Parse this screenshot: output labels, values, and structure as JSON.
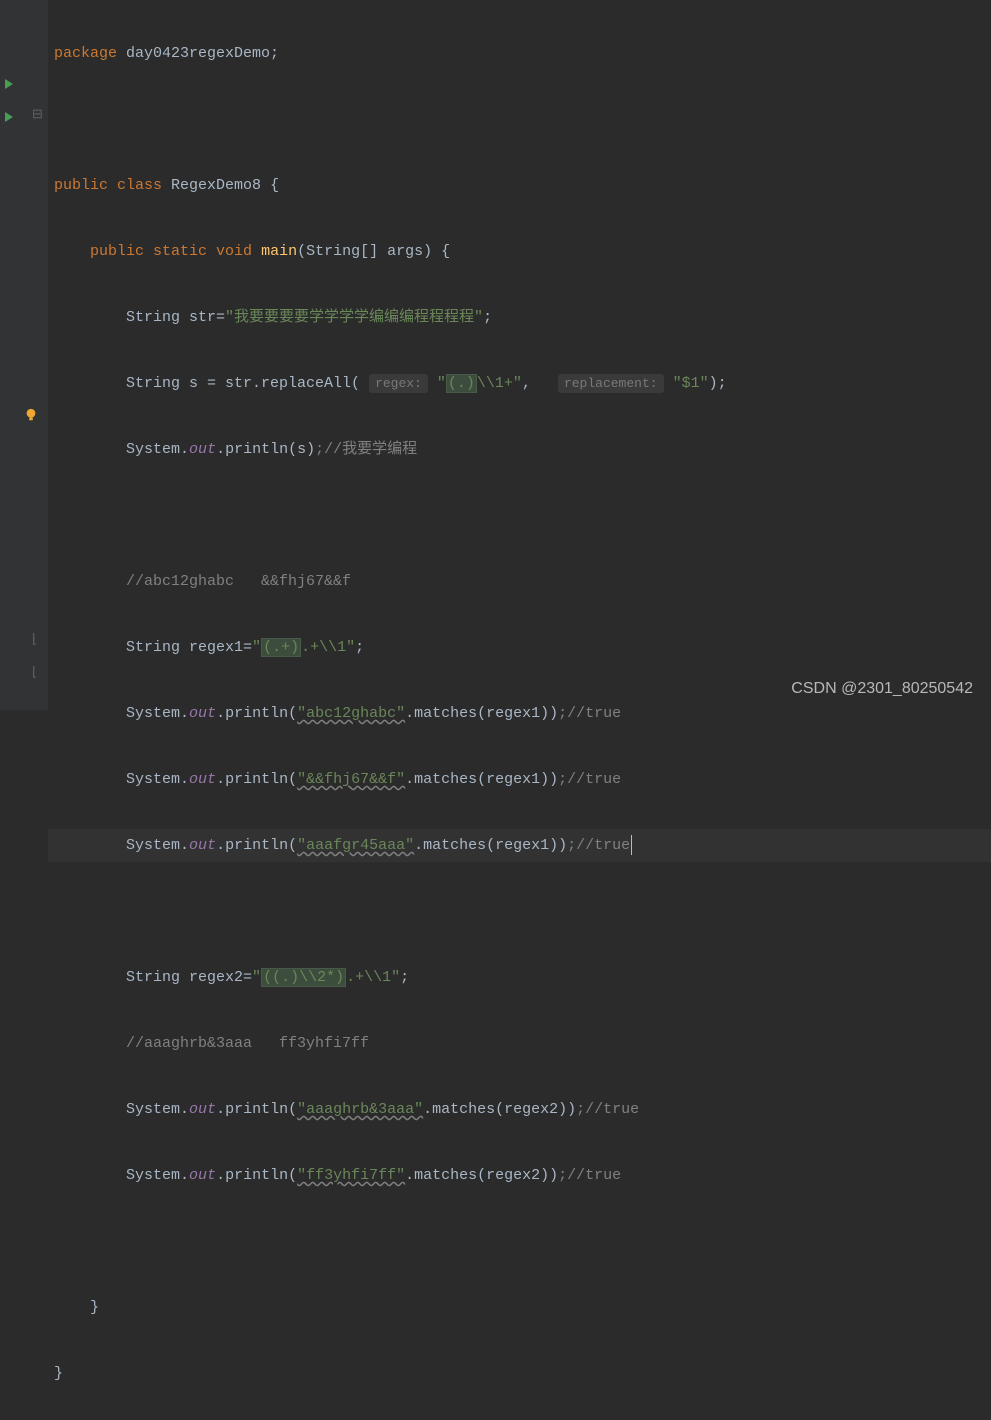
{
  "watermark": "CSDN @2301_80250542",
  "code": {
    "package_kw": "package ",
    "package_name": "day0423regexDemo",
    "semi": ";",
    "public": "public ",
    "class_kw": "class ",
    "class_name": "RegexDemo8 ",
    "brace_o": "{",
    "brace_c": "}",
    "static": "static ",
    "void": "void ",
    "main": "main",
    "main_params": "(String[] args) ",
    "str_decl": "String str=",
    "str_val": "\"我要要要要学学学学编编编程程程程\"",
    "s_decl": "String s = str.replaceAll( ",
    "regex_hint": "regex:",
    "regex_val_open": "\"",
    "regex_val_hl": "(.)",
    "regex_val_rest": "\\\\1+\"",
    "comma": ",   ",
    "repl_hint": "replacement:",
    "repl_val": " \"$1\"",
    "paren_close": ")",
    "sout": "System",
    "dot": ".",
    "out": "out",
    "println": "println",
    "s_arg": "(s)",
    "cmt1": ";//我要学编程",
    "cmt2": "//abc12ghabc   &&fhj67&&f",
    "regex1_decl": "String regex1=",
    "regex1_open": "\"",
    "regex1_hl": "(.+)",
    "regex1_rest": ".+\\\\1\"",
    "m1_open": "(",
    "m1_str": "\"abc12ghabc\"",
    "m1_call": ".matches(regex1))",
    "cmt_true": ";//true",
    "m2_str": "\"&&fhj67&&f\"",
    "m3_str": "\"aaafgr45aaa\"",
    "regex2_decl": "String regex2=",
    "regex2_open": "\"",
    "regex2_hl": "((.)\\\\2*)",
    "regex2_rest": ".+\\\\1\"",
    "cmt3": "//aaaghrb&3aaa   ff3yhfi7ff",
    "m4_str": "\"aaaghrb&3aaa\"",
    "m4_call": ".matches(regex2))",
    "m5_str": "\"ff3yhfi7ff\""
  }
}
